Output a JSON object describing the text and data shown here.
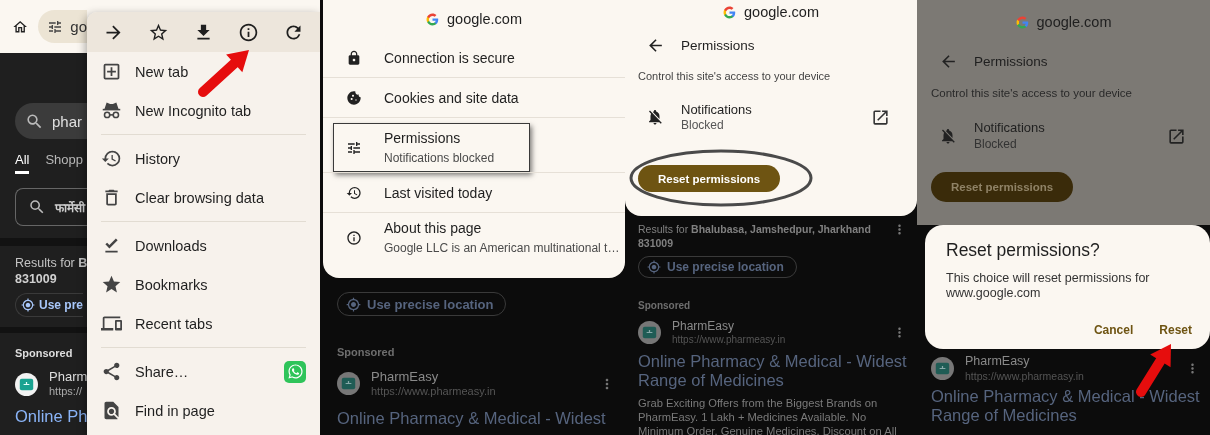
{
  "screen_1": {
    "address_bar": {
      "text": "go"
    },
    "page": {
      "query": "phar",
      "tabs": [
        {
          "label": "All",
          "selected": true
        },
        {
          "label": "Shopp",
          "selected": false
        }
      ],
      "search_field": "फार्मेसी",
      "location_line": "Results for **B**",
      "postcode": "831009",
      "location_chip": "Use pre",
      "sponsored": "Sponsored",
      "advertiser": "Pharm",
      "url": "https://",
      "title": "Online Ph"
    },
    "menu": {
      "groups": [
        [
          {
            "label": "New tab",
            "kind": "plain"
          },
          {
            "label": "New Incognito tab",
            "kind": "plain"
          }
        ],
        [
          {
            "label": "History",
            "kind": "plain"
          },
          {
            "label": "Clear browsing data",
            "kind": "plain"
          }
        ],
        [
          {
            "label": "Downloads",
            "kind": "plain"
          },
          {
            "label": "Bookmarks",
            "kind": "plain"
          },
          {
            "label": "Recent tabs",
            "kind": "plain"
          }
        ],
        [
          {
            "label": "Share…",
            "kind": "share"
          },
          {
            "label": "Find in page",
            "kind": "plain"
          }
        ]
      ]
    }
  },
  "screen_2": {
    "site": "google.com",
    "rows": [
      {
        "title": "Connection is secure",
        "highlighted": false
      },
      {
        "title": "Cookies and site data",
        "highlighted": false
      },
      {
        "title": "Permissions",
        "subtitle": "Notifications blocked",
        "highlighted": true
      },
      {
        "title": "Last visited today",
        "highlighted": false
      },
      {
        "title": "About this page",
        "subtitle": "Google LLC is an American multinational t…",
        "highlighted": false
      }
    ],
    "page": {
      "location_chip": "Use precise location",
      "sponsored": "Sponsored",
      "advertiser": "PharmEasy",
      "url": "https://www.pharmeasy.in",
      "title": "Online Pharmacy & Medical - Widest"
    }
  },
  "screen_3": {
    "site": "google.com",
    "heading": "Permissions",
    "description": "Control this site's access to your device",
    "permission": {
      "name": "Notifications",
      "status": "Blocked"
    },
    "reset_button": {
      "label": "Reset permissions",
      "highlighted": true
    },
    "page": {
      "location_line": "Results for **Bhalubasa, Jamshedpur, Jharkhand 831009**",
      "location_chip": "Use precise location",
      "sponsored": "Sponsored",
      "advertiser": "PharmEasy",
      "url": "https://www.pharmeasy.in",
      "title": "Online Pharmacy & Medical - Widest Range of Medicines",
      "snippet": "Grab Exciting Offers from the Biggest Brands on PharmEasy. 1 Lakh + Medicines Available. No Minimum Order. Genuine Medicines. Discount on All"
    }
  },
  "screen_4": {
    "site": "google.com",
    "heading": "Permissions",
    "description": "Control this site's access to your device",
    "permission": {
      "name": "Notifications",
      "status": "Blocked"
    },
    "reset_button": {
      "label": "Reset permissions"
    },
    "dialog": {
      "title": "Reset permissions?",
      "message": "This choice will reset permissions for www.google.com",
      "buttons": [
        "Cancel",
        "Reset"
      ]
    },
    "page": {
      "advertiser": "PharmEasy",
      "url": "https://www.pharmeasy.in",
      "title": "Online Pharmacy & Medical - Widest Range of Medicines"
    }
  }
}
